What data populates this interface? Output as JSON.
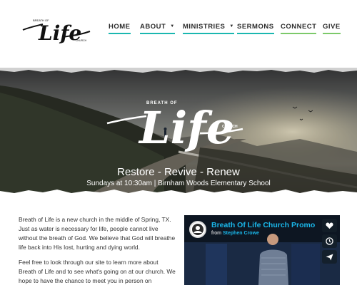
{
  "nav": {
    "items": [
      {
        "label": "HOME",
        "underline": "#1ab7b0"
      },
      {
        "label": "ABOUT",
        "underline": "#1ab7b0",
        "dropdown": true
      },
      {
        "label": "MINISTRIES",
        "underline": "#1ab7b0",
        "dropdown": true
      },
      {
        "label": "SERMONS",
        "underline": "#1ab7b0"
      },
      {
        "label": "CONNECT",
        "underline": "#7cc96a"
      },
      {
        "label": "GIVE",
        "underline": "#7cc96a"
      }
    ],
    "caret": "▼"
  },
  "logo": {
    "text": "Life",
    "small_top": "BREATH OF",
    "small_bottom": "CHURCH"
  },
  "hero": {
    "logo_text": "Life",
    "logo_small_top": "BREATH OF",
    "logo_small_bottom": "CHURCH",
    "tagline": "Restore - Revive - Renew",
    "service_info": "Sundays at 10:30am | Birnham Woods Elementary School"
  },
  "content": {
    "paragraph1": "Breath of Life is a new church in the middle of Spring, TX. Just as water is necessary for life, people cannot live without the breath of God. We believe that God will breathe life back into His lost, hurting and dying world.",
    "paragraph2": "Feel free to look through our site to learn more about Breath of Life and to see what's going on at our church. We hope to have the chance to meet you in person on"
  },
  "video": {
    "title": "Breath Of Life Church Promo",
    "from_label": "from",
    "author": "Stephen Crowe",
    "buttons": [
      "heart-icon",
      "clock-icon",
      "send-icon"
    ]
  },
  "colors": {
    "accent_teal": "#1ab7b0",
    "accent_green": "#7cc96a",
    "vimeo_blue": "#1ab7ea"
  }
}
